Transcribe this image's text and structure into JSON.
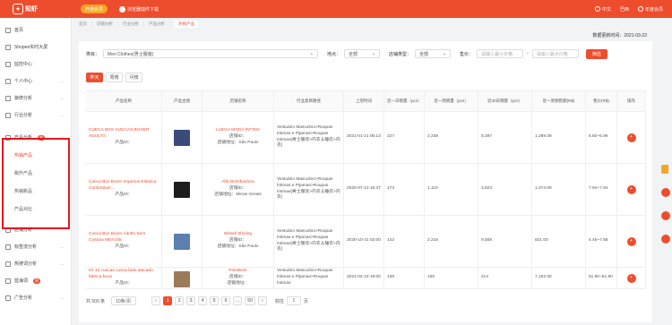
{
  "topbar": {
    "logo_text": "知虾",
    "vip_label": "开通会员",
    "plugin_label": "浏览器插件下载",
    "lang": "中文",
    "region": "巴西",
    "member": "年度会员"
  },
  "sidebar": {
    "items": [
      {
        "label": "首页"
      },
      {
        "label": "Shopee实时大屏"
      },
      {
        "label": "监控中心"
      },
      {
        "label": "个人中心"
      },
      {
        "label": "装修分析"
      },
      {
        "label": "行业分析"
      },
      {
        "label": "产品分析",
        "badge": "热"
      },
      {
        "label": "热销产品"
      },
      {
        "label": "飙升产品"
      },
      {
        "label": "热销新品"
      },
      {
        "label": "产品对比"
      },
      {
        "label": "店铺分析"
      },
      {
        "label": "标签流分析"
      },
      {
        "label": "热搜词分析"
      },
      {
        "label": "蓝海词"
      },
      {
        "label": "广告分析"
      }
    ]
  },
  "breadcrumb": [
    "首页",
    "店铺分析",
    "行业分析",
    "产品分析",
    "热销产品"
  ],
  "updated": {
    "label": "数据更新时间：",
    "value": "2021-03-22"
  },
  "filters": {
    "category_label": "类目：",
    "category_value": "Men Clothes(男士服装)",
    "location_label": "地点：",
    "location_value": "全部",
    "type_label": "店铺类型：",
    "type_value": "全部",
    "price_label": "售价：",
    "price_min_placeholder": "请输入最小价格",
    "price_max_placeholder": "请输入最大价格",
    "search_button": "筛选"
  },
  "period_tabs": [
    "昨天",
    "周榜",
    "月榜"
  ],
  "table": {
    "headers": [
      "产品名称",
      "产品主图",
      "店铺名称",
      "行业类目路径",
      "上架时间",
      "近一日销量（pcs）",
      "近一周销量（pcs）",
      "近30日销量（pcs）",
      "近一周销售额(R$)",
      "售价(R$)",
      "操作"
    ],
    "rows": [
      {
        "name": "CUECA BOX CUECAS BOXER ADULTO",
        "id_label": "产品ID：",
        "shop": "LUEGA MODA ÍNTIMA",
        "shop_id_label": "店铺ID：",
        "location": "店铺地址：São Paulo",
        "path": "Vestuário Masculino>Roupas Íntimas e Pijamas>Roupas Íntimas(男士服装>内衣＆睡衣>内衣)",
        "date": "2021-01-21 06:13",
        "day": "227",
        "week": "2,238",
        "month": "8,397",
        "revenue": "1,289.09",
        "price": "5.60~5.98",
        "thumb_color": "#3a4b7a"
      },
      {
        "name": "Cueca Box Boxer Imperius Elástica Confortável ...",
        "id_label": "产品ID：",
        "shop": "Alfa Distribuidora",
        "shop_id_label": "店铺ID：",
        "location": "店铺地址：Minas Gerais",
        "path": "Vestuário Masculino>Roupas Íntimas e Pijamas>Roupas Íntimas(男士服装>内衣＆睡衣>内衣)",
        "date": "2020-07-13 16:37",
        "day": "173",
        "week": "1,119",
        "month": "3,823",
        "revenue": "1,374.09",
        "price": "7.94~7.94",
        "thumb_color": "#1d1d1d"
      },
      {
        "name": "Cueca Box Boxer Adulto Sem Costura MEN blic",
        "id_label": "产品ID：",
        "shop": "Wilsell Shining",
        "shop_id_label": "店铺ID：",
        "location": "店铺地址：São Paulo",
        "path": "Vestuário Masculino>Roupas Íntimas e Pijamas>Roupas Íntimas(男士服装>内衣＆睡衣>内衣)",
        "date": "2020-10-31 02:00",
        "day": "142",
        "week": "2,215",
        "month": "9,558",
        "revenue": "821.00",
        "price": "4.45~7.68",
        "thumb_color": "#5b7fb0"
      },
      {
        "name": "Kit 10 cuecas cueca balo atacado fabrica boxe",
        "id_label": "产品ID：",
        "shop": "PoloBeck",
        "shop_id_label": "店铺ID：",
        "location": "店铺地址：",
        "path": "Vestuário Masculino>Roupas Íntimas e Pijamas>Roupas Íntimas",
        "date": "2021-02-23 19:00",
        "day": "138",
        "week": "155",
        "month": "214",
        "revenue": "7,162.00",
        "price": "51.90~51.90",
        "thumb_color": "#9b7b5a"
      }
    ]
  },
  "pager": {
    "total": "共 500 条",
    "page_size": "10条/页",
    "pages": [
      "1",
      "2",
      "3",
      "4",
      "5",
      "6",
      "...",
      "50"
    ],
    "prev": "‹",
    "next": "›",
    "goto_label": "前往",
    "goto_value": "1",
    "page_suffix": "页"
  }
}
